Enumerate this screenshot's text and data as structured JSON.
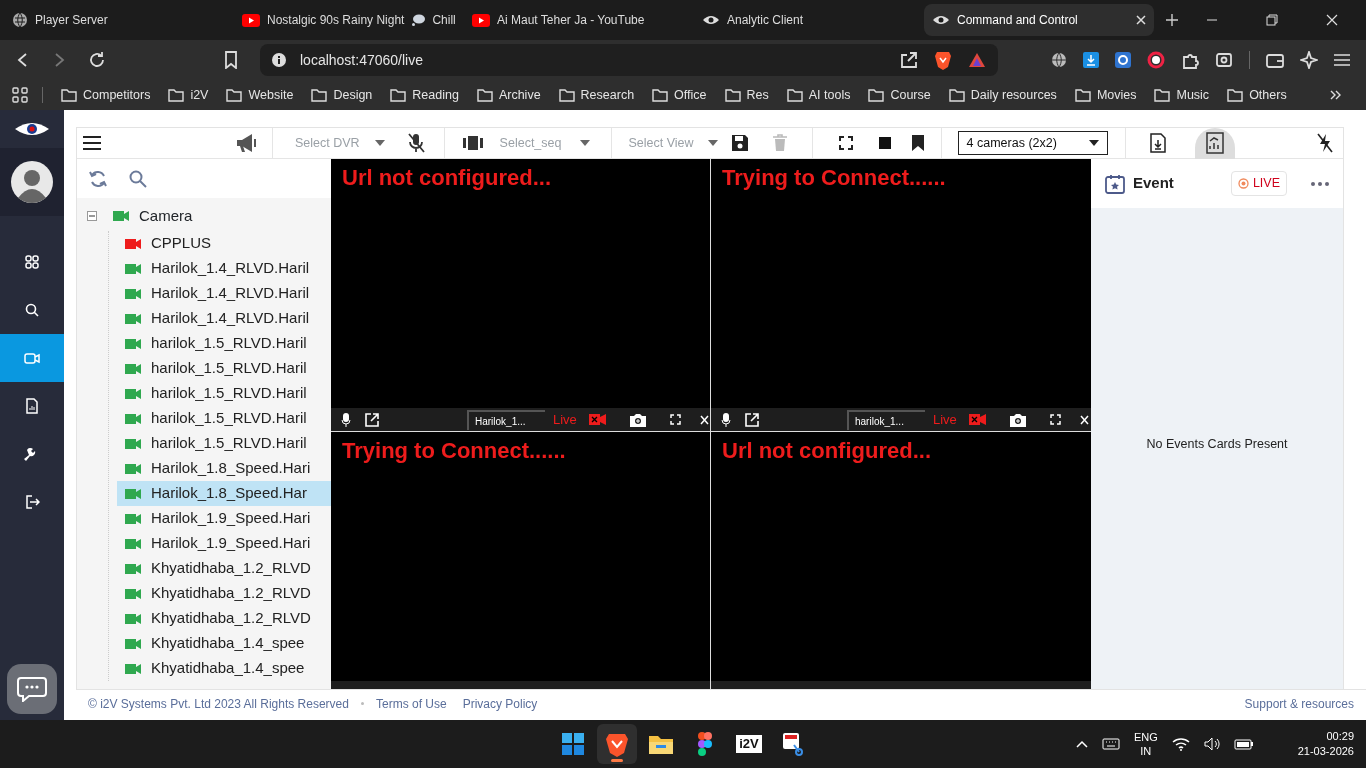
{
  "browser": {
    "tabs": [
      {
        "title": "Player Server",
        "kind": "globe",
        "selected": false
      },
      {
        "title": "Nostalgic 90s Rainy Night",
        "suffix": "Chill",
        "kind": "youtube",
        "selected": false
      },
      {
        "title": "Ai Maut Teher Ja - YouTube",
        "kind": "youtube",
        "selected": false
      },
      {
        "title": "Analytic Client",
        "kind": "eye",
        "selected": false
      },
      {
        "title": "Command and Control",
        "kind": "eye",
        "selected": true
      }
    ],
    "address": "localhost:47060/live",
    "bookmarks": [
      "Competitors",
      "i2V",
      "Website",
      "Design",
      "Reading",
      "Archive",
      "Research",
      "Office",
      "Res",
      "AI tools",
      "Course",
      "Daily resources",
      "Movies",
      "Music",
      "Others"
    ]
  },
  "sidebar": {
    "items": [
      {
        "kind": "grid",
        "selected": false
      },
      {
        "kind": "search",
        "selected": false
      },
      {
        "kind": "camera",
        "selected": true
      },
      {
        "kind": "report",
        "selected": false
      },
      {
        "kind": "wrench",
        "selected": false
      },
      {
        "kind": "logout",
        "selected": false
      }
    ]
  },
  "toolbar": {
    "dvr": {
      "placeholder": "Select DVR"
    },
    "sequence": {
      "placeholder": "Select_seq"
    },
    "view": {
      "placeholder": "Select View"
    },
    "layout": {
      "value": "4 cameras (2x2)"
    }
  },
  "tree": {
    "label": "Camera",
    "expanded": true,
    "children": [
      {
        "label": "CPPLUS",
        "color": "#ee1c1c",
        "selected": false
      },
      {
        "label": "Harilok_1.4_RLVD.Haril",
        "color": "#2fa84f",
        "selected": false
      },
      {
        "label": "Harilok_1.4_RLVD.Haril",
        "color": "#2fa84f",
        "selected": false
      },
      {
        "label": "Harilok_1.4_RLVD.Haril",
        "color": "#2fa84f",
        "selected": false
      },
      {
        "label": "harilok_1.5_RLVD.Haril",
        "color": "#2fa84f",
        "selected": false
      },
      {
        "label": "harilok_1.5_RLVD.Haril",
        "color": "#2fa84f",
        "selected": false
      },
      {
        "label": "harilok_1.5_RLVD.Haril",
        "color": "#2fa84f",
        "selected": false
      },
      {
        "label": "harilok_1.5_RLVD.Haril",
        "color": "#2fa84f",
        "selected": false
      },
      {
        "label": "harilok_1.5_RLVD.Haril",
        "color": "#2fa84f",
        "selected": false
      },
      {
        "label": "Harilok_1.8_Speed.Hari",
        "color": "#2fa84f",
        "selected": false
      },
      {
        "label": "Harilok_1.8_Speed.Har",
        "color": "#2fa84f",
        "selected": true
      },
      {
        "label": "Harilok_1.9_Speed.Hari",
        "color": "#2fa84f",
        "selected": false
      },
      {
        "label": "Harilok_1.9_Speed.Hari",
        "color": "#2fa84f",
        "selected": false
      },
      {
        "label": "Khyatidhaba_1.2_RLVD",
        "color": "#2fa84f",
        "selected": false
      },
      {
        "label": "Khyatidhaba_1.2_RLVD",
        "color": "#2fa84f",
        "selected": false
      },
      {
        "label": "Khyatidhaba_1.2_RLVD",
        "color": "#2fa84f",
        "selected": false
      },
      {
        "label": "Khyatidhaba_1.4_spee",
        "color": "#2fa84f",
        "selected": false
      },
      {
        "label": "Khyatidhaba_1.4_spee",
        "color": "#2fa84f",
        "selected": false
      }
    ]
  },
  "tiles": [
    {
      "message": "Url not configured...",
      "camera": "Harilok_1...",
      "status": "Live"
    },
    {
      "message": "Trying to Connect......",
      "camera": "harilok_1...",
      "status": "Live"
    },
    {
      "message": "Trying to Connect......"
    },
    {
      "message": "Url not configured..."
    }
  ],
  "events": {
    "title": "Event",
    "live": "LIVE",
    "empty": "No Events Cards Present"
  },
  "footer": {
    "copyright": "© i2V Systems Pvt. Ltd 2023 All Rights Reserved",
    "links": [
      "Terms of Use",
      "Privacy Policy"
    ],
    "support": "Support & resources"
  },
  "taskbar": {
    "apps": [
      {
        "kind": "windows",
        "selected": false
      },
      {
        "kind": "brave",
        "selected": true
      },
      {
        "kind": "folder",
        "selected": false
      },
      {
        "kind": "figma",
        "selected": false
      },
      {
        "kind": "i2v",
        "label": "i2V",
        "selected": false
      },
      {
        "kind": "snip",
        "selected": false
      }
    ],
    "language": "ENG",
    "region": "IN",
    "time": "00:29",
    "date": "21-03-2026"
  }
}
